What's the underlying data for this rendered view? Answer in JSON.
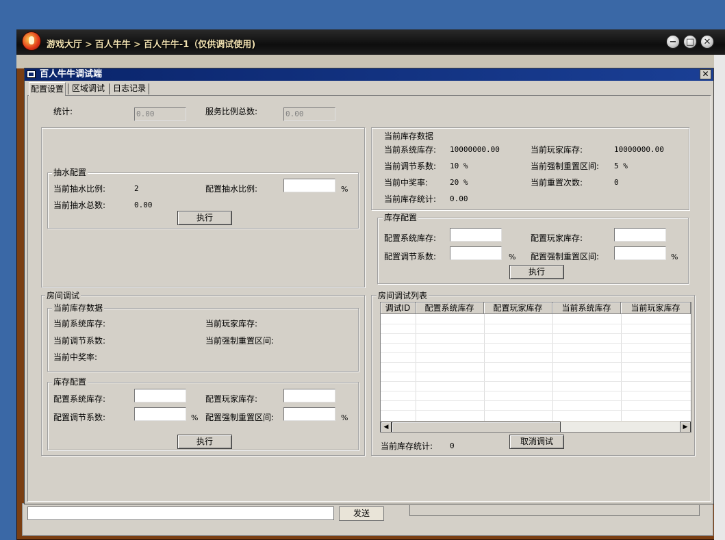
{
  "outer_window": {
    "breadcrumb": [
      "游戏大厅",
      "百人牛牛",
      "百人牛牛-1（仅供调试使用)"
    ],
    "separator": ">",
    "buttons": {
      "minimize": "−",
      "maximize": "□",
      "close": "✕"
    },
    "send_label": "发送"
  },
  "dialog": {
    "title": "百人牛牛调试端",
    "close": "✕",
    "tabs": [
      "配置设置",
      "区域调试",
      "日志记录"
    ],
    "active_tab": 0
  },
  "stats": {
    "total_label": "统计:",
    "total_value": "0.00",
    "service_label": "服务比例总数:",
    "service_value": "0.00"
  },
  "tax": {
    "legend": "抽水配置",
    "current_ratio_label": "当前抽水比例:",
    "current_ratio_value": "2",
    "config_ratio_label": "配置抽水比例:",
    "percent": "%",
    "current_total_label": "当前抽水总数:",
    "current_total_value": "0.00",
    "execute_label": "执行"
  },
  "global_stock": {
    "legend": "当前库存数据",
    "system_stock_label": "当前系统库存:",
    "system_stock_value": "10000000.00",
    "player_stock_label": "当前玩家库存:",
    "player_stock_value": "10000000.00",
    "adjust_coef_label": "当前调节系数:",
    "adjust_coef_value": "10 %",
    "force_reset_label": "当前强制重置区间:",
    "force_reset_value": "5 %",
    "win_rate_label": "当前中奖率:",
    "win_rate_value": "20 %",
    "reset_count_label": "当前重置次数:",
    "reset_count_value": "0",
    "stock_total_label": "当前库存统计:",
    "stock_total_value": "0.00"
  },
  "global_config": {
    "legend": "库存配置",
    "system_stock_label": "配置系统库存:",
    "player_stock_label": "配置玩家库存:",
    "adjust_coef_label": "配置调节系数:",
    "force_reset_label": "配置强制重置区间:",
    "percent": "%",
    "execute_label": "执行"
  },
  "room_debug": {
    "legend": "房间调试",
    "stock_legend": "当前库存数据",
    "system_stock_label": "当前系统库存:",
    "player_stock_label": "当前玩家库存:",
    "adjust_coef_label": "当前调节系数:",
    "force_reset_label": "当前强制重置区间:",
    "win_rate_label": "当前中奖率:",
    "config_legend": "库存配置",
    "cfg_system_stock_label": "配置系统库存:",
    "cfg_player_stock_label": "配置玩家库存:",
    "cfg_adjust_coef_label": "配置调节系数:",
    "cfg_force_reset_label": "配置强制重置区间:",
    "percent": "%",
    "execute_label": "执行"
  },
  "room_list": {
    "legend": "房间调试列表",
    "columns": [
      "调试ID",
      "配置系统库存",
      "配置玩家库存",
      "当前系统库存",
      "当前玩家库存"
    ],
    "rows": [],
    "stock_total_label": "当前库存统计:",
    "stock_total_value": "0",
    "cancel_label": "取消调试"
  }
}
